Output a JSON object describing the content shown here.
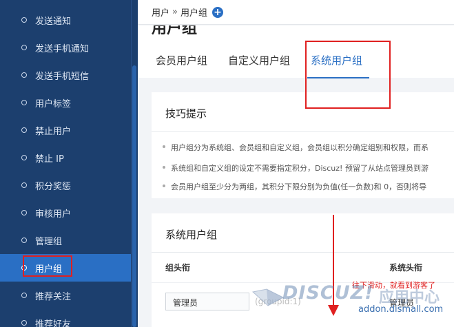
{
  "sidebar": {
    "items": [
      {
        "label": "发送通知",
        "active": false
      },
      {
        "label": "发送手机通知",
        "active": false
      },
      {
        "label": "发送手机短信",
        "active": false
      },
      {
        "label": "用户标签",
        "active": false
      },
      {
        "label": "禁止用户",
        "active": false
      },
      {
        "label": "禁止 IP",
        "active": false
      },
      {
        "label": "积分奖惩",
        "active": false
      },
      {
        "label": "审核用户",
        "active": false
      },
      {
        "label": "管理组",
        "active": false
      },
      {
        "label": "用户组",
        "active": true
      },
      {
        "label": "推荐关注",
        "active": false
      },
      {
        "label": "推荐好友",
        "active": false
      }
    ]
  },
  "breadcrumb": {
    "root": "用户",
    "separator": "»",
    "current": "用户组"
  },
  "page": {
    "title": "用户组"
  },
  "tabs": [
    {
      "label": "会员用户组",
      "active": false
    },
    {
      "label": "自定义用户组",
      "active": false
    },
    {
      "label": "系统用户组",
      "active": true
    }
  ],
  "tips": {
    "title": "技巧提示",
    "lines": [
      "用户组分为系统组、会员组和自定义组，会员组以积分确定组别和权限，而系",
      "系统组和自定义组的设定不需要指定积分，Discuz! 预留了从站点管理员到游",
      "会员用户组至少分为两组，其积分下限分别为负值(任一负数)和 0，否则将导"
    ]
  },
  "system_groups": {
    "title": "系统用户组",
    "columns": [
      "组头衔",
      "系统头衔"
    ],
    "rows": [
      {
        "name": "管理员",
        "group_id": "(groupid:1)",
        "system_title": "管理员"
      }
    ]
  },
  "annotation": {
    "text": "往下滑动，就看到游客了"
  },
  "watermark": {
    "logo": "DISCUZ!",
    "cn": "应用中心",
    "url": "addon.dismall.com"
  },
  "colors": {
    "sidebar_bg": "#1c3f6e",
    "accent": "#2a6fc4",
    "highlight": "#e02020"
  }
}
